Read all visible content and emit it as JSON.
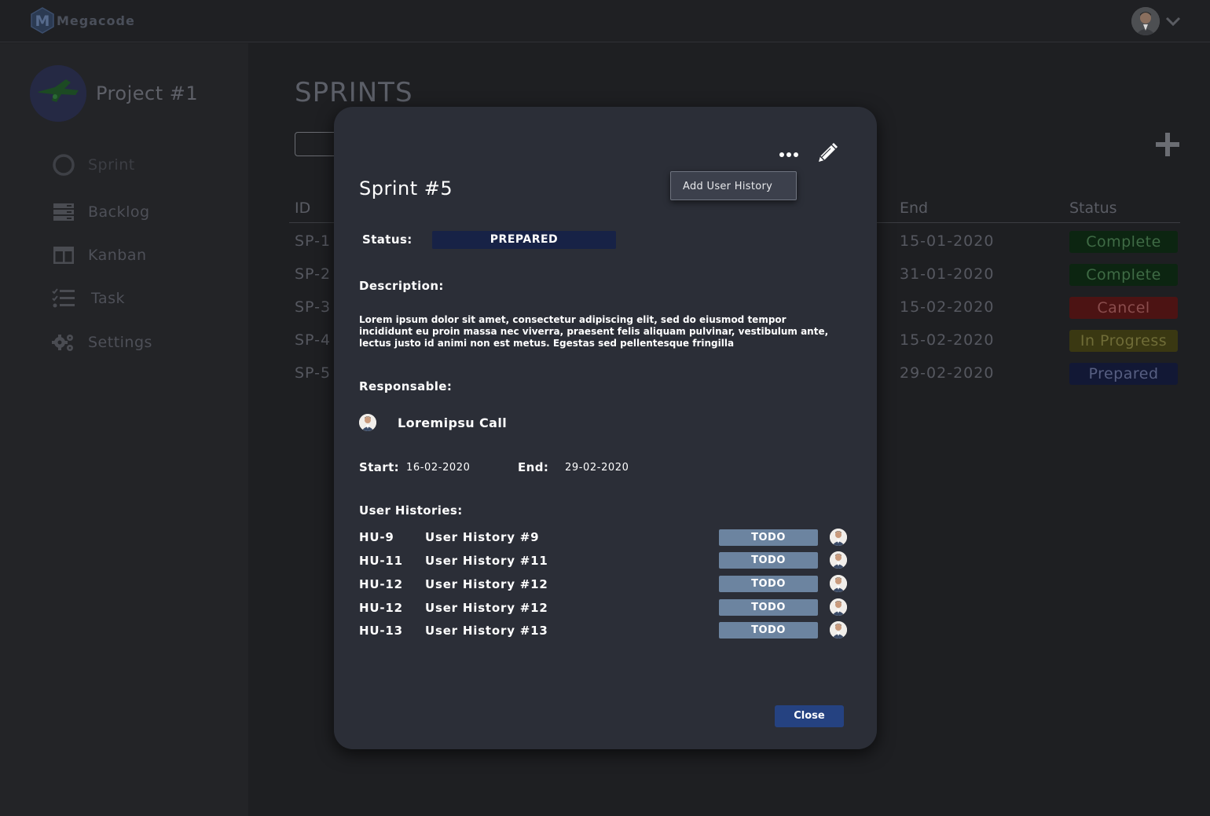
{
  "app": {
    "brand": "Megacode",
    "logo_letter": "M"
  },
  "sidebar": {
    "project_name": "Project #1",
    "items": [
      {
        "label": "Sprint",
        "icon": "sprint-ring-icon"
      },
      {
        "label": "Backlog",
        "icon": "backlog-icon"
      },
      {
        "label": "Kanban",
        "icon": "kanban-icon"
      },
      {
        "label": "Task",
        "icon": "task-list-icon"
      },
      {
        "label": "Settings",
        "icon": "settings-gears-icon"
      }
    ]
  },
  "main": {
    "title": "SPRINTS",
    "columns": {
      "id": "ID",
      "end": "End",
      "status": "Status"
    },
    "rows": [
      {
        "id": "SP-1",
        "end": "15-01-2020",
        "status": "Complete"
      },
      {
        "id": "SP-2",
        "end": "31-01-2020",
        "status": "Complete"
      },
      {
        "id": "SP-3",
        "end": "15-02-2020",
        "status": "Cancel"
      },
      {
        "id": "SP-4",
        "end": "15-02-2020",
        "status": "In Progress"
      },
      {
        "id": "SP-5",
        "end": "29-02-2020",
        "status": "Prepared"
      }
    ]
  },
  "modal": {
    "title": "Sprint #5",
    "menu_item": "Add User History",
    "status_label": "Status:",
    "status_value": "PREPARED",
    "description_label": "Description:",
    "description": "Lorem ipsum dolor sit amet, consectetur adipiscing elit, sed do eiusmod tempor incididunt eu proin massa nec viverra, praesent felis aliquam pulvinar, vestibulum ante, lectus justo id animi non est metus. Egestas sed pellentesque fringilla",
    "responsable_label": "Responsable:",
    "responsable_name": "Loremipsu Call",
    "start_label": "Start:",
    "start_value": "16-02-2020",
    "end_label": "End:",
    "end_value": "29-02-2020",
    "histories_label": "User Histories:",
    "histories": [
      {
        "id": "HU-9",
        "name": "User History #9",
        "status": "TODO"
      },
      {
        "id": "HU-11",
        "name": "User History #11",
        "status": "TODO"
      },
      {
        "id": "HU-12",
        "name": "User History #12",
        "status": "TODO"
      },
      {
        "id": "HU-12",
        "name": "User History #12",
        "status": "TODO"
      },
      {
        "id": "HU-13",
        "name": "User History #13",
        "status": "TODO"
      }
    ],
    "close_label": "Close"
  },
  "colors": {
    "complete_bg": "#0c2511",
    "complete_fg": "#3f6b45",
    "cancel_bg": "#4c1313",
    "cancel_fg": "#8a4d4d",
    "progress_bg": "#3a3812",
    "progress_fg": "#6f6c37",
    "prepared_bg": "#121835",
    "prepared_fg": "#575f82",
    "modal_status_bg": "#172246",
    "todo_bg": "#6c84a0",
    "close_bg": "#254281"
  }
}
